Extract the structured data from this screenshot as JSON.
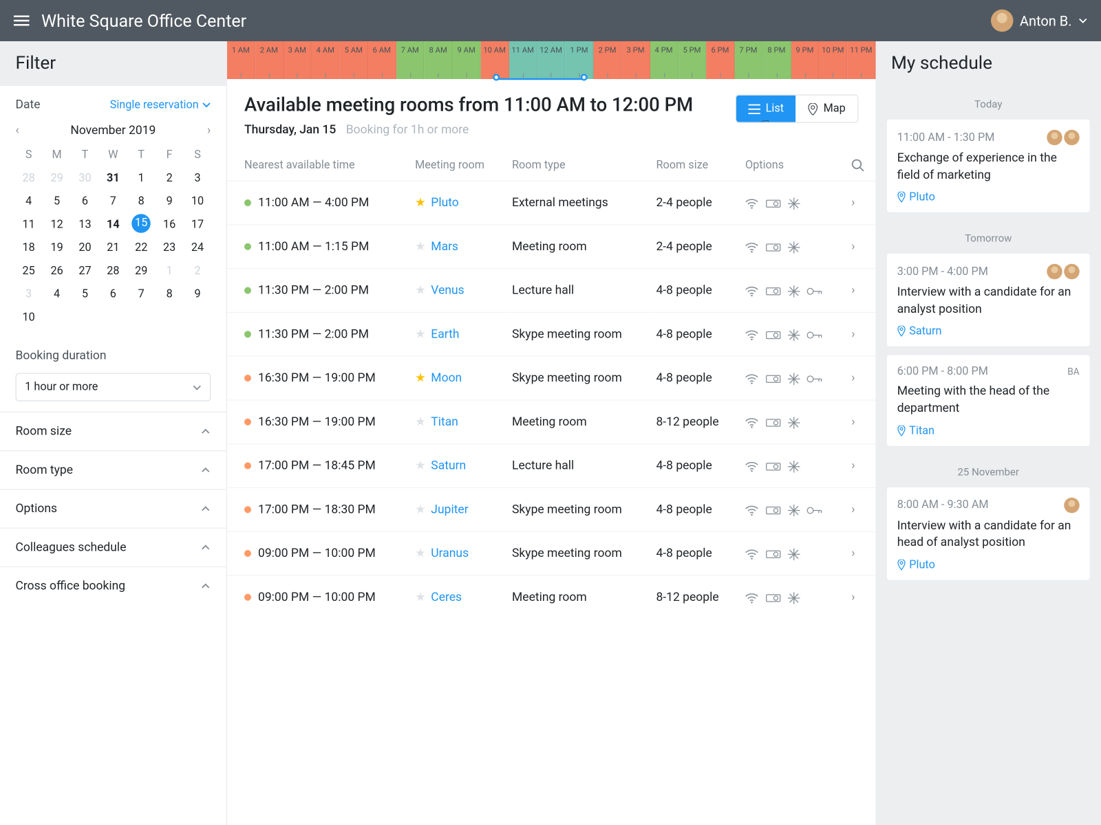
{
  "header": {
    "title": "White Square Office Center",
    "user": "Anton B."
  },
  "filter": {
    "title": "Filter",
    "date_label": "Date",
    "reservation_mode": "Single reservation",
    "calendar": {
      "month": "November 2019",
      "dow": [
        "S",
        "M",
        "T",
        "W",
        "T",
        "F",
        "S"
      ],
      "cells": [
        {
          "d": "28",
          "dim": true
        },
        {
          "d": "29",
          "dim": true
        },
        {
          "d": "30",
          "dim": true
        },
        {
          "d": "31",
          "bold": true
        },
        {
          "d": "1"
        },
        {
          "d": "2"
        },
        {
          "d": "3"
        },
        {
          "d": "4"
        },
        {
          "d": "5"
        },
        {
          "d": "6"
        },
        {
          "d": "7"
        },
        {
          "d": "8"
        },
        {
          "d": "9"
        },
        {
          "d": "10"
        },
        {
          "d": "11"
        },
        {
          "d": "12"
        },
        {
          "d": "13"
        },
        {
          "d": "14",
          "bold": true
        },
        {
          "d": "15",
          "selected": true
        },
        {
          "d": "16"
        },
        {
          "d": "17"
        },
        {
          "d": "18"
        },
        {
          "d": "19"
        },
        {
          "d": "20"
        },
        {
          "d": "21"
        },
        {
          "d": "22"
        },
        {
          "d": "23"
        },
        {
          "d": "24"
        },
        {
          "d": "25"
        },
        {
          "d": "26"
        },
        {
          "d": "27"
        },
        {
          "d": "28"
        },
        {
          "d": "29"
        },
        {
          "d": "1",
          "dim": true
        },
        {
          "d": "2",
          "dim": true
        },
        {
          "d": "3",
          "dim": true
        },
        {
          "d": "4"
        },
        {
          "d": "5"
        },
        {
          "d": "6"
        },
        {
          "d": "7"
        },
        {
          "d": "8"
        },
        {
          "d": "9"
        },
        {
          "d": "10"
        }
      ]
    },
    "duration_label": "Booking duration",
    "duration_value": "1 hour or more",
    "accordion": [
      "Room size",
      "Room type",
      "Options",
      "Colleagues schedule",
      "Cross office booking"
    ]
  },
  "timeline": {
    "hours": [
      {
        "l": "1 AM",
        "c": "r"
      },
      {
        "l": "2 AM",
        "c": "r"
      },
      {
        "l": "3 AM",
        "c": "r"
      },
      {
        "l": "4 AM",
        "c": "r"
      },
      {
        "l": "5 AM",
        "c": "r"
      },
      {
        "l": "6 AM",
        "c": "r"
      },
      {
        "l": "7 AM",
        "c": "g"
      },
      {
        "l": "8 AM",
        "c": "g"
      },
      {
        "l": "9 AM",
        "c": "g"
      },
      {
        "l": "10 AM",
        "c": "r"
      },
      {
        "l": "11 AM",
        "c": "b"
      },
      {
        "l": "12 AM",
        "c": "b"
      },
      {
        "l": "1 PM",
        "c": "b"
      },
      {
        "l": "2 PM",
        "c": "r"
      },
      {
        "l": "3 PM",
        "c": "r"
      },
      {
        "l": "4 PM",
        "c": "g"
      },
      {
        "l": "5 PM",
        "c": "g"
      },
      {
        "l": "6 PM",
        "c": "r"
      },
      {
        "l": "7 PM",
        "c": "g"
      },
      {
        "l": "8 PM",
        "c": "g"
      },
      {
        "l": "9 PM",
        "c": "r"
      },
      {
        "l": "10 PM",
        "c": "r"
      },
      {
        "l": "11 PM",
        "c": "r"
      }
    ],
    "slider_start_pct": 41.5,
    "slider_end_pct": 55.0
  },
  "main": {
    "title": "Available meeting rooms from 11:00 AM to 12:00 PM",
    "day": "Thursday, Jan 15",
    "hint": "Booking for 1h or more",
    "view": {
      "list": "List",
      "map": "Map"
    },
    "columns": [
      "Nearest available time",
      "Meeting room",
      "Room type",
      "Room size",
      "Options",
      ""
    ],
    "rooms": [
      {
        "dot": "g",
        "time": "11:00 AM — 4:00 PM",
        "star": true,
        "name": "Pluto",
        "type": "External meetings",
        "size": "2-4 people",
        "opts": [
          "wifi",
          "proj",
          "ac"
        ]
      },
      {
        "dot": "g",
        "time": "11:00 AM — 1:15 PM",
        "star": false,
        "name": "Mars",
        "type": "Meeting room",
        "size": "2-4 people",
        "opts": [
          "wifi",
          "proj",
          "ac"
        ]
      },
      {
        "dot": "g",
        "time": "11:30 PM — 2:00 PM",
        "star": false,
        "name": "Venus",
        "type": "Lecture hall",
        "size": "4-8 people",
        "opts": [
          "wifi",
          "proj",
          "ac",
          "key"
        ]
      },
      {
        "dot": "g",
        "time": "11:30 PM — 2:00 PM",
        "star": false,
        "name": "Earth",
        "type": "Skype meeting room",
        "size": "4-8 people",
        "opts": [
          "wifi",
          "proj",
          "ac",
          "key"
        ]
      },
      {
        "dot": "o",
        "time": "16:30 PM — 19:00 PM",
        "star": true,
        "name": "Moon",
        "type": "Skype meeting room",
        "size": "4-8 people",
        "opts": [
          "wifi",
          "proj",
          "ac",
          "key"
        ]
      },
      {
        "dot": "o",
        "time": "16:30 PM — 19:00 PM",
        "star": false,
        "name": "Titan",
        "type": "Meeting room",
        "size": "8-12 people",
        "opts": [
          "wifi",
          "proj",
          "ac"
        ]
      },
      {
        "dot": "o",
        "time": "17:00 PM — 18:45 PM",
        "star": false,
        "name": "Saturn",
        "type": "Lecture hall",
        "size": "4-8 people",
        "opts": [
          "wifi",
          "proj",
          "ac"
        ]
      },
      {
        "dot": "o",
        "time": "17:00 PM — 18:30 PM",
        "star": false,
        "name": "Jupiter",
        "type": "Skype meeting room",
        "size": "4-8 people",
        "opts": [
          "wifi",
          "proj",
          "ac",
          "key"
        ]
      },
      {
        "dot": "o",
        "time": "09:00 PM — 10:00 PM",
        "star": false,
        "name": "Uranus",
        "type": "Skype meeting room",
        "size": "4-8 people",
        "opts": [
          "wifi",
          "proj",
          "ac"
        ]
      },
      {
        "dot": "o",
        "time": "09:00 PM — 10:00 PM",
        "star": false,
        "name": "Ceres",
        "type": "Meeting room",
        "size": "8-12 people",
        "opts": [
          "wifi",
          "proj",
          "ac"
        ]
      }
    ]
  },
  "schedule": {
    "title": "My schedule",
    "groups": [
      {
        "label": "Today",
        "items": [
          {
            "time": "11:00 AM - 1:30 PM",
            "title": "Exchange of experience in the field of marketing",
            "loc": "Pluto",
            "att": 2
          }
        ]
      },
      {
        "label": "Tomorrow",
        "items": [
          {
            "time": "3:00 PM - 4:00 PM",
            "title": "Interview with a candidate for an analyst position",
            "loc": "Saturn",
            "att": 2
          },
          {
            "time": "6:00 PM - 8:00 PM",
            "title": "Meeting with the head of the department",
            "loc": "Titan",
            "badge": "BA"
          }
        ]
      },
      {
        "label": "25 November",
        "items": [
          {
            "time": "8:00 AM - 9:30 AM",
            "title": "Interview with a candidate for an head of analyst position",
            "loc": "Pluto",
            "att": 1
          }
        ]
      }
    ]
  }
}
